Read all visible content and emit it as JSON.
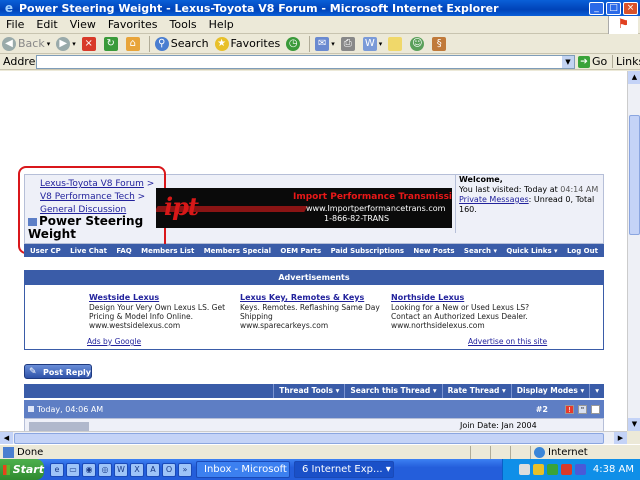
{
  "window": {
    "title": "Power Steering Weight - Lexus-Toyota V8 Forum - Microsoft Internet Explorer",
    "controls": [
      "_",
      "□",
      "×"
    ]
  },
  "menu": [
    "File",
    "Edit",
    "View",
    "Favorites",
    "Tools",
    "Help"
  ],
  "toolbar": {
    "back": "Back",
    "search": "Search",
    "favorites": "Favorites"
  },
  "address": {
    "label": "Address",
    "value": "",
    "go": "Go",
    "links": "Links"
  },
  "forum": {
    "breadcrumb": {
      "root": "Lexus-Toyota V8 Forum",
      "sep1": ">",
      "section": "V8 Performance Tech",
      "sep2": ">",
      "subsection": "General Discussion"
    },
    "thread_title": "Power Steering Weight",
    "banner": {
      "logo": "ipt",
      "headline": "Import Performance Transmissions",
      "url": "www.Importperformancetrans.com",
      "phone": "1-866-82-TRANS"
    },
    "welcome": {
      "greeting": "Welcome,",
      "last_visited_label": "You last visited: Today at",
      "last_visited_time": "04:14 AM",
      "pm_label": "Private Messages",
      "pm_counts": ": Unread 0, Total 160."
    },
    "navbar": [
      "User CP",
      "Live Chat",
      "FAQ",
      "Members List",
      "Members Special",
      "OEM Parts",
      "Paid Subscriptions",
      "New Posts",
      "Search ▾",
      "Quick Links ▾",
      "Log Out"
    ],
    "ads": {
      "header": "Advertisements",
      "items": [
        {
          "title": "Westside Lexus",
          "desc": "Design Your Very Own Lexus LS. Get Pricing & Model Info Online.",
          "url": "www.westsidelexus.com"
        },
        {
          "title": "Lexus Key, Remotes & Keys",
          "desc": "Keys. Remotes. Reflashing Same Day Shipping",
          "url": "www.sparecarkeys.com"
        },
        {
          "title": "Northside Lexus",
          "desc": "Looking for a New or Used Lexus LS? Contact an Authorized Lexus Dealer.",
          "url": "www.northsidelexus.com"
        }
      ],
      "ads_by": "Ads by Google",
      "advertise": "Advertise on this site"
    },
    "post_reply": "Post Reply",
    "thread_tools": [
      "Thread Tools ▾",
      "Search this Thread ▾",
      "Rate Thread ▾",
      "Display Modes ▾",
      "▾"
    ],
    "post": {
      "date": "Today, 04:06 AM",
      "number": "#2",
      "join_date": "Join Date: Jan 2004"
    }
  },
  "status": {
    "text": "Done",
    "zone": "Internet"
  },
  "taskbar": {
    "start": "Start",
    "tasks": [
      "Inbox - Microsoft ...",
      "6 Internet Exp... ▾"
    ],
    "clock": "4:38 AM"
  }
}
